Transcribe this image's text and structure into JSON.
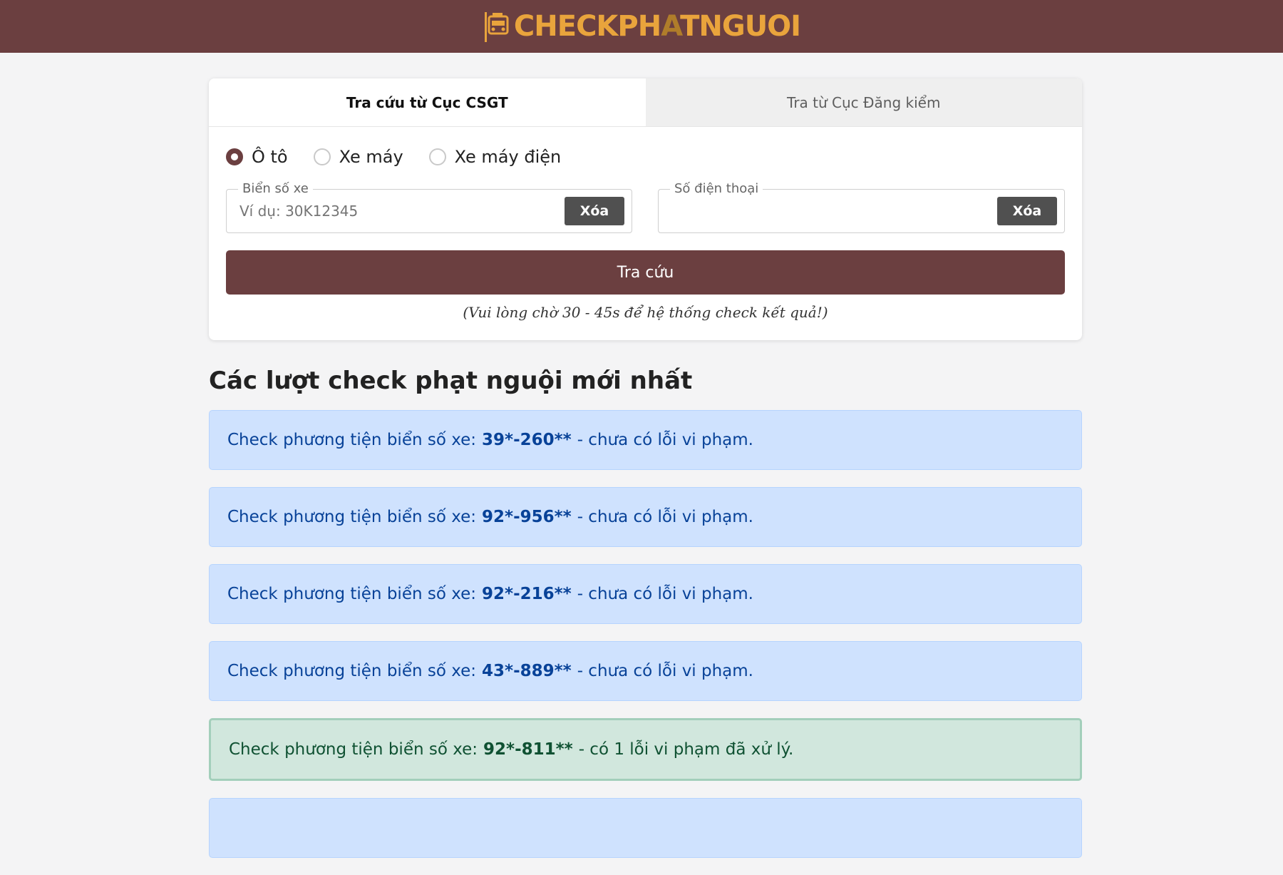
{
  "brand": {
    "pre": "CHECKPH",
    "highlight": "A",
    "post": "TNGUOI"
  },
  "tabs": [
    {
      "label": "Tra cứu từ Cục CSGT",
      "active": true
    },
    {
      "label": "Tra từ Cục Đăng kiểm",
      "active": false
    }
  ],
  "vehicle_types": [
    {
      "label": "Ô tô",
      "checked": true
    },
    {
      "label": "Xe máy",
      "checked": false
    },
    {
      "label": "Xe máy điện",
      "checked": false
    }
  ],
  "plate_field": {
    "legend": "Biển số xe",
    "placeholder": "Ví dụ: 30K12345",
    "clear_label": "Xóa"
  },
  "phone_field": {
    "legend": "Số điện thoại",
    "placeholder": "",
    "clear_label": "Xóa"
  },
  "submit_label": "Tra cứu",
  "note": "(Vui lòng chờ 30 - 45s để hệ thống check kết quả!)",
  "section_title": "Các lượt check phạt nguội mới nhất",
  "checks": [
    {
      "prefix": "Check phương tiện biển số xe:",
      "plate": "39*-260**",
      "result": "- chưa có lỗi vi phạm.",
      "status": "info"
    },
    {
      "prefix": "Check phương tiện biển số xe:",
      "plate": "92*-956**",
      "result": "- chưa có lỗi vi phạm.",
      "status": "info"
    },
    {
      "prefix": "Check phương tiện biển số xe:",
      "plate": "92*-216**",
      "result": "- chưa có lỗi vi phạm.",
      "status": "info"
    },
    {
      "prefix": "Check phương tiện biển số xe:",
      "plate": "43*-889**",
      "result": "- chưa có lỗi vi phạm.",
      "status": "info"
    },
    {
      "prefix": "Check phương tiện biển số xe:",
      "plate": "92*-811**",
      "result": "- có 1 lỗi vi phạm đã xử lý.",
      "status": "success"
    }
  ],
  "colors": {
    "brand": "#6b3f40",
    "logo": "#e9a43c",
    "info_bg": "#cfe2fe",
    "success_bg": "#d1e7dd"
  }
}
